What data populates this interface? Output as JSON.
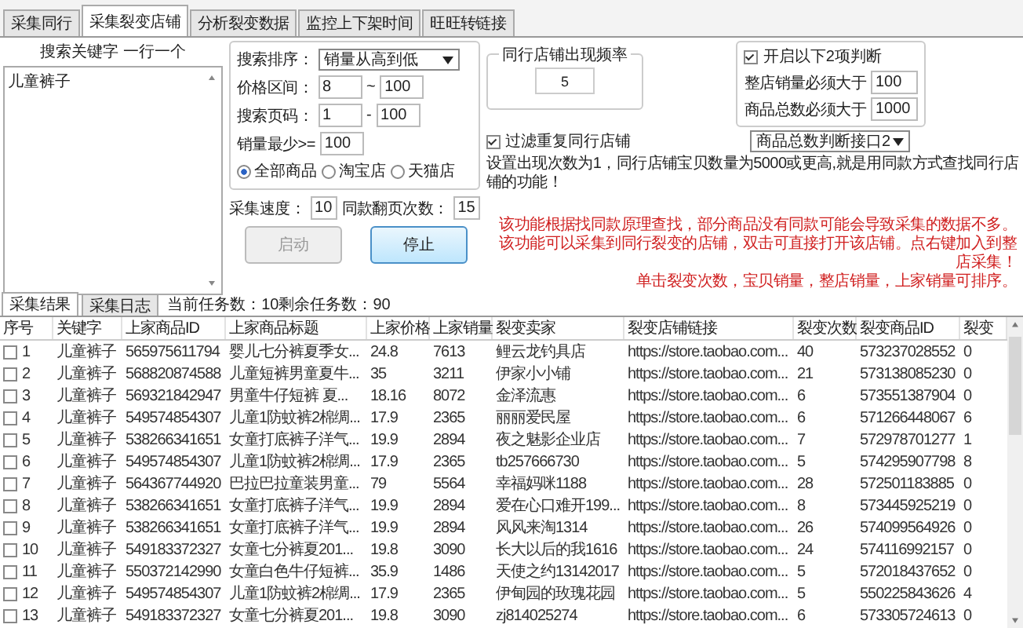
{
  "tabs": [
    {
      "label": "采集同行",
      "selected": false
    },
    {
      "label": "采集裂变店铺",
      "selected": true
    },
    {
      "label": "分析裂变数据",
      "selected": false
    },
    {
      "label": "监控上下架时间",
      "selected": false
    },
    {
      "label": "旺旺转链接",
      "selected": false
    }
  ],
  "keywords": {
    "label": "搜索关键字 一行一个",
    "value": "儿童裤子"
  },
  "search": {
    "sort_label": "搜索排序：",
    "sort_value": "销量从高到低",
    "ranges": [
      {
        "label": "价格区间：",
        "min": "8",
        "separator": "~",
        "max": "100"
      },
      {
        "label": "搜索页码：",
        "min": "1",
        "separator": "-",
        "max": "100"
      }
    ],
    "min_sales": {
      "label": "销量最少>=",
      "value": "100"
    },
    "scope": [
      {
        "label": "全部商品",
        "selected": true
      },
      {
        "label": "淘宝店",
        "selected": false
      },
      {
        "label": "天猫店",
        "selected": false
      }
    ]
  },
  "speed": {
    "label": "采集速度：",
    "value": "10"
  },
  "page_turns": {
    "label": "同款翻页次数：",
    "value": "15"
  },
  "buttons": [
    {
      "label": "启动",
      "disabled": true
    },
    {
      "label": "停止",
      "disabled": false
    }
  ],
  "frequency": {
    "title": "同行店铺出现频率",
    "value": "5"
  },
  "judge": {
    "label": "开启以下2项判断",
    "checked": true,
    "fields": [
      {
        "label": "整店销量必须大于",
        "value": "100"
      },
      {
        "label": "商品总数必须大于",
        "value": "1000"
      }
    ]
  },
  "interface_select": "商品总数判断接口2",
  "filter": {
    "label": "过滤重复同行店铺",
    "checked": true
  },
  "note": "设置出现次数为1，同行店铺宝贝数量为5000或更高,就是用同款方式查找同行店铺的功能！",
  "warnings": [
    "该功能根据找同款原理查找，部分商品没有同款可能会导致采集的数据不多。",
    "该功能可以采集到同行裂变的店铺，双击可直接打开该店铺。点右键加入到整店采集！",
    "单击裂变次数，宝贝销量，整店销量，上家销量可排序。"
  ],
  "result_tabs": [
    {
      "label": "采集结果",
      "selected": true
    },
    {
      "label": "采集日志",
      "selected": false
    }
  ],
  "status": "当前任务数：10剩余任务数：90",
  "table": {
    "columns": [
      "序号",
      "关键字",
      "上家商品ID",
      "上家商品标题",
      "上家价格",
      "上家销量",
      "裂变卖家",
      "裂变店铺链接",
      "裂变次数",
      "裂变商品ID",
      "裂变"
    ],
    "rows": [
      {
        "checked": false,
        "cells": [
          "1",
          "儿童裤子",
          "565975611794",
          "婴儿七分裤夏季女...",
          "24.8",
          "7613",
          "鲤云龙钓具店",
          "https://store.taobao.com...",
          "40",
          "573237028552",
          "0"
        ]
      },
      {
        "checked": false,
        "cells": [
          "2",
          "儿童裤子",
          "568820874588",
          "儿童短裤男童夏牛...",
          "35",
          "3211",
          "伊家小小铺",
          "https://store.taobao.com...",
          "21",
          "573138085230",
          "0"
        ]
      },
      {
        "checked": false,
        "cells": [
          "3",
          "儿童裤子",
          "569321842947",
          "男童牛仔短裤 夏...",
          "18.16",
          "8072",
          "金泽流惠",
          "https://store.taobao.com...",
          "6",
          "573551387904",
          "0"
        ]
      },
      {
        "checked": false,
        "cells": [
          "4",
          "儿童裤子",
          "549574854307",
          "儿童1防蚊裤2棉绸...",
          "17.9",
          "2365",
          "丽丽爱民屋",
          "https://store.taobao.com...",
          "6",
          "571266448067",
          "6"
        ]
      },
      {
        "checked": false,
        "cells": [
          "5",
          "儿童裤子",
          "538266341651",
          "女童打底裤子洋气...",
          "19.9",
          "2894",
          "夜之魅影企业店",
          "https://store.taobao.com...",
          "7",
          "572978701277",
          "1"
        ]
      },
      {
        "checked": false,
        "cells": [
          "6",
          "儿童裤子",
          "549574854307",
          "儿童1防蚊裤2棉绸...",
          "17.9",
          "2365",
          "tb257666730",
          "https://store.taobao.com...",
          "5",
          "574295907798",
          "8"
        ]
      },
      {
        "checked": false,
        "cells": [
          "7",
          "儿童裤子",
          "564367744920",
          "巴拉巴拉童装男童...",
          "79",
          "5564",
          "幸福妈咪1188",
          "https://store.taobao.com...",
          "28",
          "572501183885",
          "0"
        ]
      },
      {
        "checked": false,
        "cells": [
          "8",
          "儿童裤子",
          "538266341651",
          "女童打底裤子洋气...",
          "19.9",
          "2894",
          "爱在心口难开199...",
          "https://store.taobao.com...",
          "8",
          "573445925219",
          "0"
        ]
      },
      {
        "checked": false,
        "cells": [
          "9",
          "儿童裤子",
          "538266341651",
          "女童打底裤子洋气...",
          "19.9",
          "2894",
          "风风来淘1314",
          "https://store.taobao.com...",
          "26",
          "574099564926",
          "0"
        ]
      },
      {
        "checked": false,
        "cells": [
          "10",
          "儿童裤子",
          "549183372327",
          "女童七分裤夏201...",
          "19.8",
          "3090",
          "长大以后的我1616",
          "https://store.taobao.com...",
          "24",
          "574116992157",
          "0"
        ]
      },
      {
        "checked": false,
        "cells": [
          "11",
          "儿童裤子",
          "550372142990",
          "女童白色牛仔短裤...",
          "35.9",
          "1486",
          "天使之约13142017",
          "https://store.taobao.com...",
          "5",
          "572018437652",
          "0"
        ]
      },
      {
        "checked": false,
        "cells": [
          "12",
          "儿童裤子",
          "549574854307",
          "儿童1防蚊裤2棉绸...",
          "17.9",
          "2365",
          "伊甸园的玫瑰花园",
          "https://store.taobao.com...",
          "5",
          "550225843626",
          "4"
        ]
      },
      {
        "checked": false,
        "cells": [
          "13",
          "儿童裤子",
          "549183372327",
          "女童七分裤夏201...",
          "19.8",
          "3090",
          "zj814025274",
          "https://store.taobao.com...",
          "6",
          "573305724613",
          "0"
        ]
      }
    ]
  }
}
